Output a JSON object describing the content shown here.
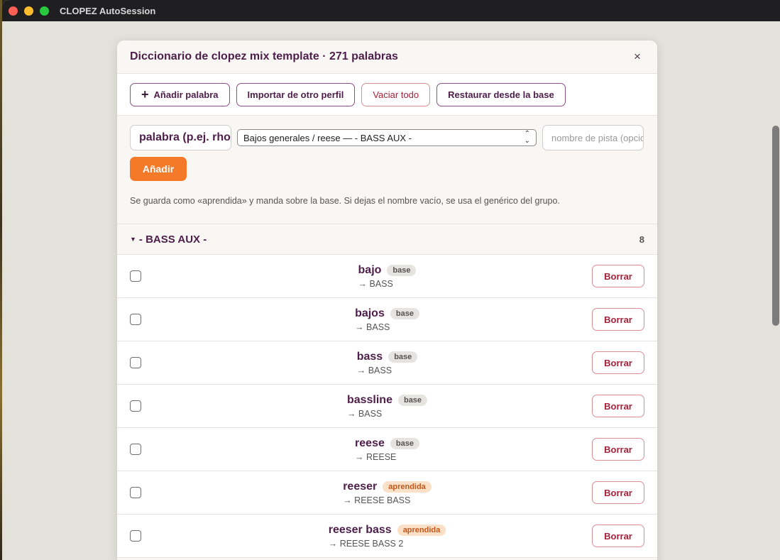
{
  "window": {
    "title": "CLOPEZ AutoSession"
  },
  "dialog": {
    "title": "Diccionario de clopez mix template · 271 palabras",
    "close_label": "×"
  },
  "toolbar": {
    "add_word_icon": "plus-icon",
    "add_word_label": "Añadir palabra",
    "import_label": "Importar de otro perfil",
    "clear_label": "Vaciar todo",
    "restore_label": "Restaurar desde la base"
  },
  "form": {
    "word_placeholder": "palabra (p.ej. rhodes)",
    "group_selected": "Bajos generales / reese — - BASS AUX -",
    "track_placeholder": "nombre de pista (opcional)",
    "add_label": "Añadir",
    "hint": "Se guarda como «aprendida» y manda sobre la base. Si dejas el nombre vacío, se usa el genérico del grupo."
  },
  "group": {
    "title": "- BASS AUX -",
    "count": "8",
    "expanded": true
  },
  "rows": [
    {
      "word": "bajo",
      "badge": "base",
      "target": "→ BASS",
      "delete_label": "Borrar"
    },
    {
      "word": "bajos",
      "badge": "base",
      "target": "→ BASS",
      "delete_label": "Borrar"
    },
    {
      "word": "bass",
      "badge": "base",
      "target": "→ BASS",
      "delete_label": "Borrar"
    },
    {
      "word": "bassline",
      "badge": "base",
      "target": "→ BASS",
      "delete_label": "Borrar"
    },
    {
      "word": "reese",
      "badge": "base",
      "target": "→ REESE",
      "delete_label": "Borrar"
    },
    {
      "word": "reeser",
      "badge": "aprendida",
      "target": "→ REESE BASS",
      "delete_label": "Borrar"
    },
    {
      "word": "reeser bass",
      "badge": "aprendida",
      "target": "→ REESE BASS 2",
      "delete_label": "Borrar"
    }
  ],
  "colors": {
    "accent": "#f47a2a",
    "brand": "#4e1e4a",
    "danger": "#a8233a",
    "learned_badge_bg": "#fbe0c8",
    "learned_badge_fg": "#c2571a"
  }
}
